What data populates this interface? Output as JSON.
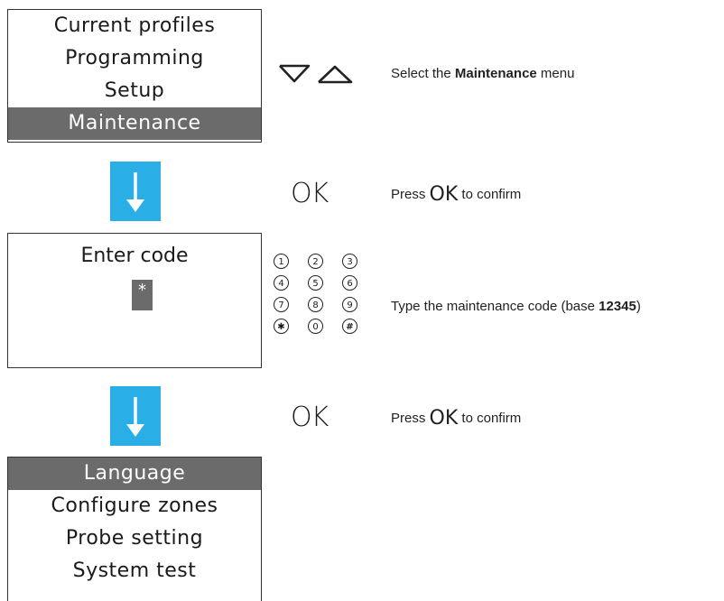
{
  "screen_menu": {
    "items": [
      "Current profiles",
      "Programming",
      "Setup",
      "Maintenance"
    ],
    "selected": "Maintenance"
  },
  "screen_code": {
    "title": "Enter code",
    "entry": "*"
  },
  "screen_maintenance": {
    "items": [
      "Language",
      "Configure zones",
      "Probe setting",
      "System test"
    ],
    "selected": "Language"
  },
  "ok_label": "OK",
  "keypad": [
    "1",
    "2",
    "3",
    "4",
    "5",
    "6",
    "7",
    "8",
    "9",
    "✱",
    "0",
    "#"
  ],
  "instructions": {
    "step1_pre": "Select the ",
    "step1_bold": "Maintenance",
    "step1_post": " menu",
    "step2_pre": "Press ",
    "step2_ok": "OK",
    "step2_post": " to confirm",
    "step3_pre": "Type the maintenance code (base ",
    "step3_bold": "12345",
    "step3_post": ")",
    "step4_pre": "Press ",
    "step4_ok": "OK",
    "step4_post": " to confirm"
  },
  "colors": {
    "arrow": "#29aee6",
    "selection": "#6b6b6b"
  }
}
